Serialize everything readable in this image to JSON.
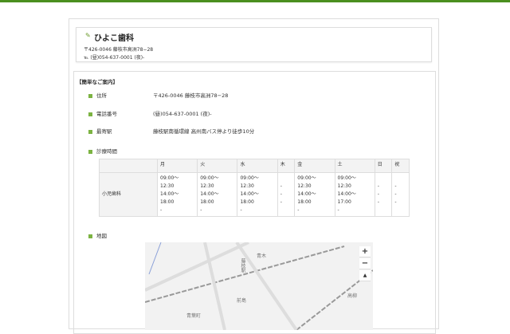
{
  "clinic": {
    "name": "ひよこ歯科",
    "address": "〒426-0046 藤枝市高洲78−28",
    "phone": "℡ (昼)054-637-0001 (夜)-"
  },
  "section_title": "【簡単なご案内】",
  "info": [
    {
      "label": "住所",
      "value": "〒426-0046 藤枝市高洲78−28"
    },
    {
      "label": "電話番号",
      "value": "(昼)054-637-0001 (夜)-"
    },
    {
      "label": "最寄駅",
      "value": "藤枝駅南循環線 高州南バス停より徒歩10分"
    },
    {
      "label": "診療時間",
      "value": ""
    }
  ],
  "hours": {
    "days": [
      "月",
      "火",
      "水",
      "木",
      "金",
      "土",
      "日",
      "祝"
    ],
    "rows": [
      {
        "dept": "小児歯科",
        "cells": [
          "09:00〜\n12:30\n14:00〜\n18:00\n-",
          "09:00〜\n12:30\n14:00〜\n18:00\n-",
          "09:00〜\n12:30\n14:00〜\n18:00\n-",
          "\n-\n-\n-",
          "09:00〜\n12:30\n14:00〜\n18:00\n-",
          "09:00〜\n12:30\n14:00〜\n17:00\n-",
          "\n-\n-\n-",
          "\n-\n-\n-"
        ]
      }
    ]
  },
  "map": {
    "label": "地図",
    "zoom_in": "+",
    "zoom_out": "−",
    "compass": "▲",
    "places": [
      "青木",
      "藤枝駅",
      "前島",
      "高柳",
      "青葉町"
    ]
  }
}
